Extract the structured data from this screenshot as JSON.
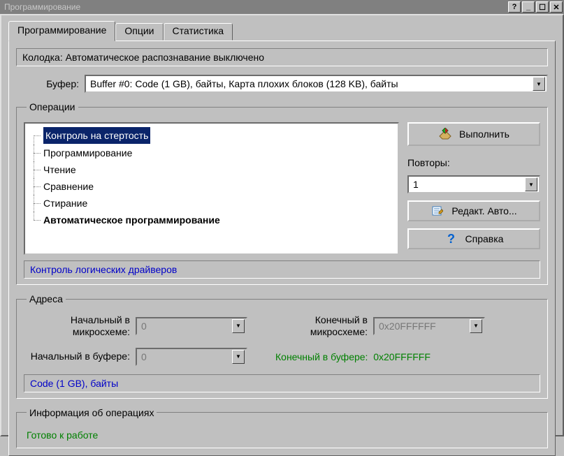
{
  "titlebar": {
    "title": "Программирование",
    "help": "?",
    "minimize": "_",
    "maximize": "☐",
    "close": "✕"
  },
  "tabs": {
    "t0": "Программирование",
    "t1": "Опции",
    "t2": "Статистика"
  },
  "socket_status": "Колодка: Автоматическое распознавание выключено",
  "buffer": {
    "label": "Буфер:",
    "value": "Buffer #0:  Code (1 GB), байты, Карта плохих блоков (128 KB), байты"
  },
  "operations": {
    "legend": "Операции",
    "items": {
      "i0": "Контроль на стертость",
      "i1": "Программирование",
      "i2": "Чтение",
      "i3": "Сравнение",
      "i4": "Стирание",
      "i5": "Автоматическое программирование"
    },
    "footer": "Контроль логических драйверов",
    "execute": "Выполнить",
    "repeats_label": "Повторы:",
    "repeats_value": "1",
    "edit_auto": "Редакт. Авто...",
    "help": "Справка"
  },
  "addresses": {
    "legend": "Адреса",
    "start_chip_label": "Начальный в микросхеме:",
    "start_chip_value": "0",
    "end_chip_label": "Конечный в микросхеме:",
    "end_chip_value": "0x20FFFFFF",
    "start_buf_label": "Начальный в буфере:",
    "start_buf_value": "0",
    "end_buf_label": "Конечный в буфере:",
    "end_buf_value": "0x20FFFFFF",
    "footer": "Code (1 GB), байты"
  },
  "info": {
    "legend": "Информация об операциях",
    "status": "Готово к работе"
  }
}
